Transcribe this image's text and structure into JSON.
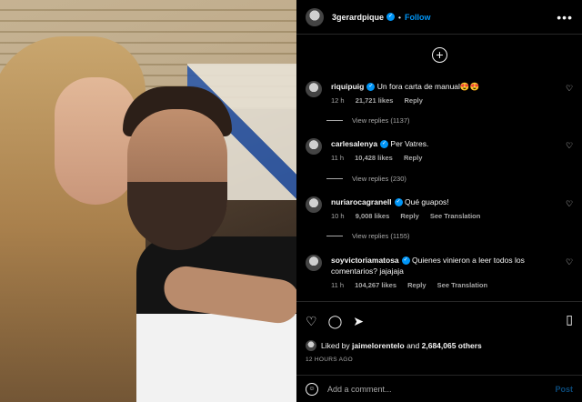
{
  "header": {
    "username": "3gerardpique",
    "follow_label": "Follow",
    "dot": "•",
    "more": "•••"
  },
  "comments": [
    {
      "user": "riquipuig",
      "text": "Un fora carta de manual😍😍",
      "time": "12 h",
      "likes": "21,721 likes",
      "reply": "Reply",
      "view_replies": "View replies (1137)"
    },
    {
      "user": "carlesalenya",
      "text": "Per Vatres.",
      "time": "11 h",
      "likes": "10,428 likes",
      "reply": "Reply",
      "view_replies": "View replies (230)"
    },
    {
      "user": "nuriarocagranell",
      "text": "Qué guapos!",
      "time": "10 h",
      "likes": "9,008 likes",
      "reply": "Reply",
      "translation": "See Translation",
      "view_replies": "View replies (1155)"
    },
    {
      "user": "soyvictoriamatosa",
      "text": "Quienes vinieron a leer todos los comentarios? jajajaja",
      "time": "11 h",
      "likes": "104,267 likes",
      "reply": "Reply",
      "translation": "See Translation"
    }
  ],
  "likes": {
    "prefix": "Liked by",
    "user": "jaimelorentelo",
    "and": "and",
    "others": "2,684,065 others"
  },
  "time_ago": "12 HOURS AGO",
  "add_comment": {
    "placeholder": "Add a comment...",
    "post_label": "Post"
  },
  "icons": {
    "like": "heart-icon",
    "comment": "comment-icon",
    "share": "share-icon",
    "save": "bookmark-icon",
    "emoji": "emoji-icon",
    "add": "plus-circle-icon"
  },
  "colors": {
    "accent": "#0095f6",
    "muted": "#a8a8a8",
    "background": "#000000"
  }
}
